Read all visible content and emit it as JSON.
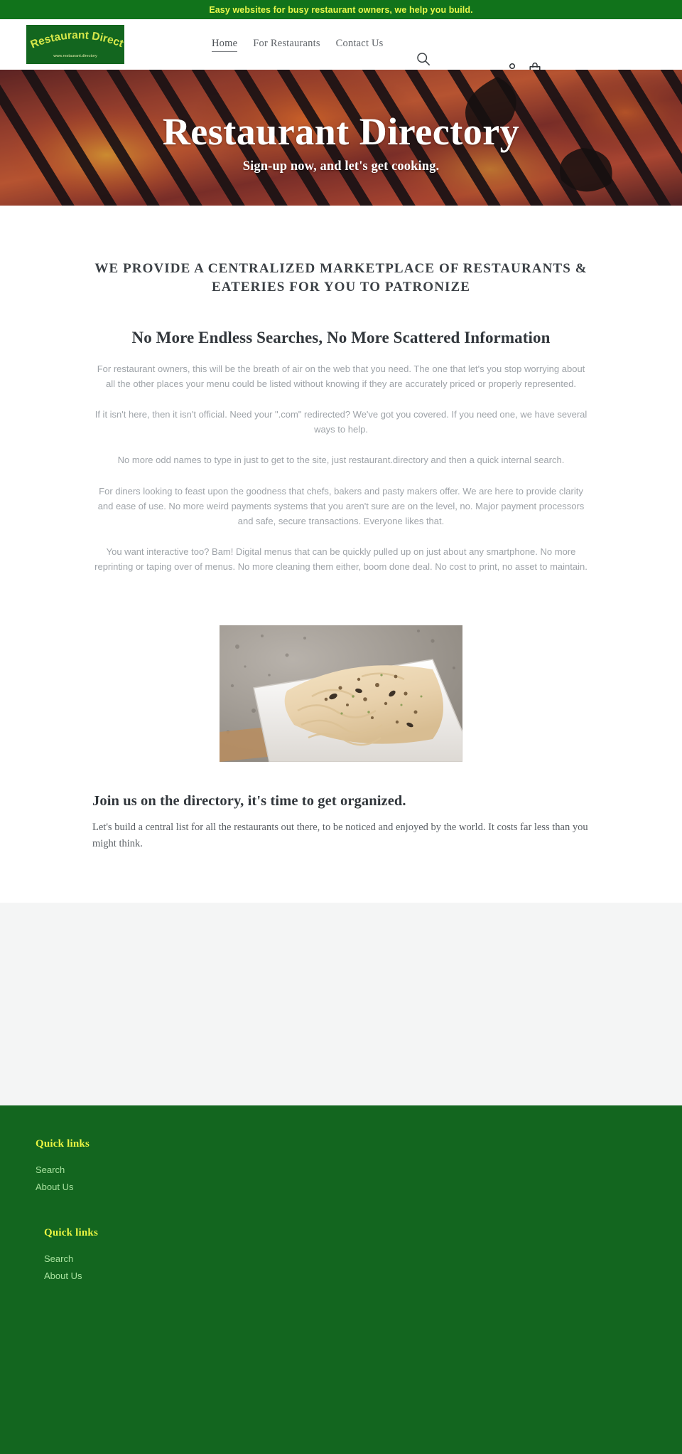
{
  "announcement": {
    "text": "Easy websites for busy restaurant owners, we help you build.",
    "bg_color": "#11731b",
    "text_color": "#e9f84c"
  },
  "header": {
    "logo": {
      "title": "Restaurant Directory",
      "subtitle": "www.restaurant.directory",
      "bg_color": "#13661f",
      "text_color": "#d6e84a"
    },
    "nav": [
      {
        "label": "Home",
        "active": true
      },
      {
        "label": "For Restaurants",
        "active": false
      },
      {
        "label": "Contact Us",
        "active": false
      }
    ],
    "icons": {
      "search": "search-icon",
      "account": "account-icon",
      "cart": "cart-icon"
    }
  },
  "hero": {
    "title": "Restaurant Directory",
    "subtitle": "Sign-up now, and let's get cooking.",
    "background_description": "charcoal grill with glowing embers"
  },
  "main": {
    "section_heading": "WE PROVIDE A CENTRALIZED MARKETPLACE OF RESTAURANTS & EATERIES FOR YOU TO PATRONIZE",
    "sub_heading": "No More Endless Searches, No More Scattered Information",
    "paragraphs": [
      "For restaurant owners, this will be the breath of air on the web that you need. The one that let's you stop worrying about all the other places your menu could be listed without knowing if they are accurately priced or properly represented.",
      "If it isn't here, then it isn't official. Need your \".com\" redirected? We've got you covered. If you need one, we have several ways to help.",
      "No more odd names to type in just to get to the site, just restaurant.directory and then a quick internal search.",
      "For diners looking to feast upon the goodness that chefs, bakers and pasty makers offer. We are here to provide clarity and ease of use. No more weird payments systems that you aren't sure are on the level, no. Major payment processors and safe, secure transactions. Everyone likes that.",
      "You want interactive too? Bam! Digital menus that can be quickly pulled up on just about any smartphone. No more reprinting or taping over of menus. No more cleaning them either, boom done deal. No cost to print, no asset to maintain."
    ],
    "image_alt": "bowl of seasoned noodles",
    "join_title": "Join us on the directory, it's time to get organized.",
    "join_text": "Let's build a central list for all the restaurants out there, to be noticed and enjoyed by the world. It costs far less than you might think."
  },
  "footer": {
    "bg_color": "#13661f",
    "title_color": "#eaf542",
    "link_color": "#a9e29f",
    "blocks": [
      {
        "title": "Quick links",
        "links": [
          "Search",
          "About Us"
        ]
      },
      {
        "title": "Quick links",
        "links": [
          "Search",
          "About Us"
        ]
      }
    ]
  }
}
